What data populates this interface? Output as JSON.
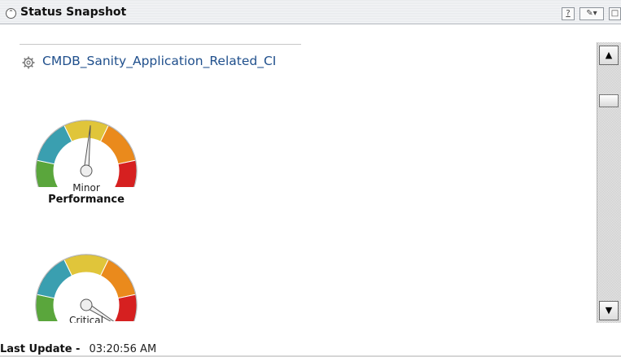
{
  "portlet": {
    "title": "Status Snapshot",
    "help_label": "?",
    "edit_label": "✎▾",
    "maximize_label": "□",
    "collapse_label": "⌃"
  },
  "application": {
    "name": "CMDB_Sanity_Application_Related_CI",
    "icon": "gear-icon"
  },
  "gauges": [
    {
      "status": "Minor",
      "label": "Performance",
      "needle_value": 0.52
    },
    {
      "status": "Critical",
      "label": "",
      "needle_value": 0.97
    }
  ],
  "gauge_colors": [
    "#5aa63c",
    "#3a9fb0",
    "#e0c53a",
    "#ea8a1c",
    "#d62020"
  ],
  "scrollbar": {
    "up_label": "▲",
    "down_label": "▼"
  },
  "footer": {
    "label": "Last Update -",
    "time": "03:20:56 AM"
  }
}
